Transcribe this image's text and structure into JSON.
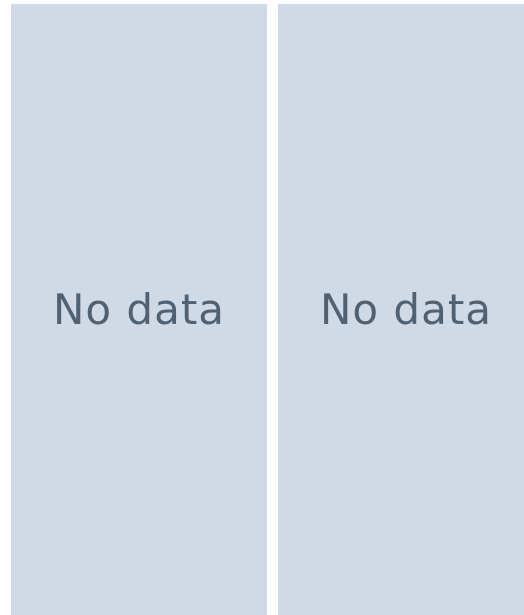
{
  "panels": [
    {
      "empty_label": "No data"
    },
    {
      "empty_label": "No data"
    }
  ],
  "colors": {
    "panel_background": "#d0dae6",
    "label_text": "#4f6173",
    "page_background": "#ffffff"
  }
}
